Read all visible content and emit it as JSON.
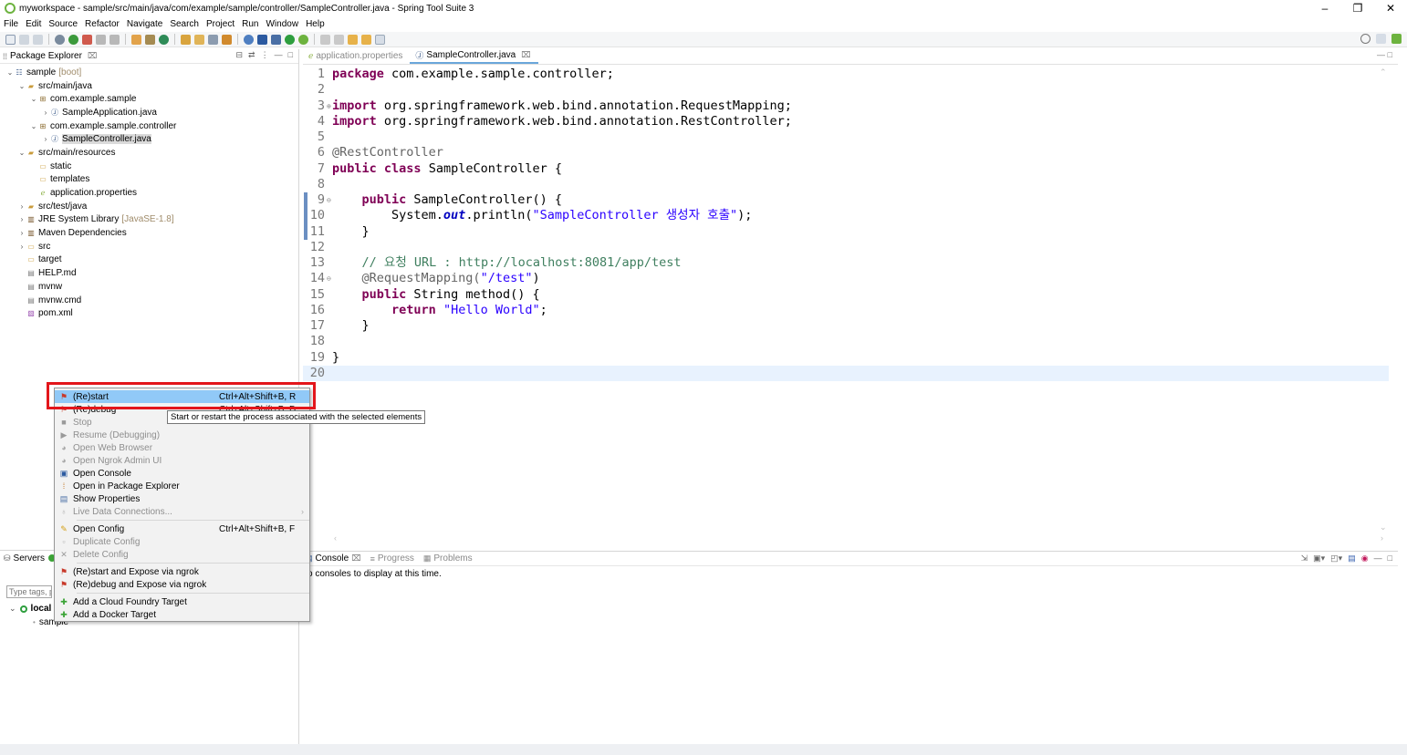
{
  "window": {
    "title": "myworkspace - sample/src/main/java/com/example/sample/controller/SampleController.java - Spring Tool Suite 3",
    "controls": [
      "–",
      "❐",
      "✕"
    ]
  },
  "menubar": [
    "File",
    "Edit",
    "Source",
    "Refactor",
    "Navigate",
    "Search",
    "Project",
    "Run",
    "Window",
    "Help"
  ],
  "package_explorer": {
    "title": "Package Explorer",
    "close": "⌧",
    "tree": [
      {
        "label": "sample",
        "decoration": "[boot]",
        "indent": 0,
        "twisty": "⌄",
        "icon": "project-icon"
      },
      {
        "label": "src/main/java",
        "indent": 1,
        "twisty": "⌄",
        "icon": "source-folder-icon"
      },
      {
        "label": "com.example.sample",
        "indent": 2,
        "twisty": "⌄",
        "icon": "package-icon"
      },
      {
        "label": "SampleApplication.java",
        "indent": 3,
        "twisty": "›",
        "icon": "java-file-icon"
      },
      {
        "label": "com.example.sample.controller",
        "indent": 2,
        "twisty": "⌄",
        "icon": "package-icon"
      },
      {
        "label": "SampleController.java",
        "indent": 3,
        "twisty": "›",
        "icon": "java-file-icon",
        "selected": true
      },
      {
        "label": "src/main/resources",
        "indent": 1,
        "twisty": "⌄",
        "icon": "source-folder-icon"
      },
      {
        "label": "static",
        "indent": 2,
        "twisty": "",
        "icon": "folder-icon"
      },
      {
        "label": "templates",
        "indent": 2,
        "twisty": "",
        "icon": "folder-icon"
      },
      {
        "label": "application.properties",
        "indent": 2,
        "twisty": "",
        "icon": "properties-icon"
      },
      {
        "label": "src/test/java",
        "indent": 1,
        "twisty": "›",
        "icon": "source-folder-icon"
      },
      {
        "label": "JRE System Library",
        "decoration": "[JavaSE-1.8]",
        "indent": 1,
        "twisty": "›",
        "icon": "library-icon"
      },
      {
        "label": "Maven Dependencies",
        "indent": 1,
        "twisty": "›",
        "icon": "library-icon"
      },
      {
        "label": "src",
        "indent": 1,
        "twisty": "›",
        "icon": "folder-icon"
      },
      {
        "label": "target",
        "indent": 1,
        "twisty": "",
        "icon": "folder-icon"
      },
      {
        "label": "HELP.md",
        "indent": 1,
        "twisty": "",
        "icon": "file-icon"
      },
      {
        "label": "mvnw",
        "indent": 1,
        "twisty": "",
        "icon": "file-icon"
      },
      {
        "label": "mvnw.cmd",
        "indent": 1,
        "twisty": "",
        "icon": "file-icon"
      },
      {
        "label": "pom.xml",
        "indent": 1,
        "twisty": "",
        "icon": "xml-file-icon"
      }
    ]
  },
  "servers": {
    "tab_label": "Servers",
    "filter_placeholder": "Type tags, p",
    "local_label": "local",
    "child_label": "sample"
  },
  "editor": {
    "tabs": [
      {
        "label": "application.properties",
        "active": false
      },
      {
        "label": "SampleController.java",
        "active": true,
        "close": "⌧"
      }
    ],
    "lines": [
      {
        "n": "1",
        "fold": "",
        "tokens": [
          [
            "kw",
            "package"
          ],
          [
            "t",
            " com.example.sample.controller;"
          ]
        ]
      },
      {
        "n": "2",
        "fold": "",
        "tokens": []
      },
      {
        "n": "3",
        "fold": "⊕",
        "tokens": [
          [
            "kw",
            "import"
          ],
          [
            "t",
            " org.springframework.web.bind.annotation.RequestMapping;"
          ]
        ]
      },
      {
        "n": "4",
        "fold": "",
        "tokens": [
          [
            "kw",
            "import"
          ],
          [
            "t",
            " org.springframework.web.bind.annotation.RestController;"
          ]
        ]
      },
      {
        "n": "5",
        "fold": "",
        "tokens": []
      },
      {
        "n": "6",
        "fold": "",
        "tokens": [
          [
            "ann",
            "@RestController"
          ]
        ]
      },
      {
        "n": "7",
        "fold": "",
        "tokens": [
          [
            "kw",
            "public"
          ],
          [
            "t",
            " "
          ],
          [
            "kw",
            "class"
          ],
          [
            "t",
            " SampleController {"
          ]
        ]
      },
      {
        "n": "8",
        "fold": "",
        "tokens": []
      },
      {
        "n": "9",
        "fold": "⊖",
        "tokens": [
          [
            "t",
            "    "
          ],
          [
            "kw",
            "public"
          ],
          [
            "t",
            " SampleController() {"
          ]
        ]
      },
      {
        "n": "10",
        "fold": "",
        "tokens": [
          [
            "t",
            "        System."
          ],
          [
            "fld",
            "out"
          ],
          [
            "t",
            ".println("
          ],
          [
            "str",
            "\"SampleController 생성자 호출\""
          ],
          [
            "t",
            ");"
          ]
        ]
      },
      {
        "n": "11",
        "fold": "",
        "tokens": [
          [
            "t",
            "    }"
          ]
        ]
      },
      {
        "n": "12",
        "fold": "",
        "tokens": []
      },
      {
        "n": "13",
        "fold": "",
        "tokens": [
          [
            "t",
            "    "
          ],
          [
            "com",
            "// 요청 URL : http://localhost:8081/app/test"
          ]
        ]
      },
      {
        "n": "14",
        "fold": "⊖",
        "tokens": [
          [
            "t",
            "    "
          ],
          [
            "ann",
            "@RequestMapping("
          ],
          [
            "str",
            "\"/test\""
          ],
          [
            "t",
            ")"
          ]
        ]
      },
      {
        "n": "15",
        "fold": "",
        "tokens": [
          [
            "t",
            "    "
          ],
          [
            "kw",
            "public"
          ],
          [
            "t",
            " String method() {"
          ]
        ]
      },
      {
        "n": "16",
        "fold": "",
        "tokens": [
          [
            "t",
            "        "
          ],
          [
            "kw",
            "return"
          ],
          [
            "t",
            " "
          ],
          [
            "str",
            "\"Hello World\""
          ],
          [
            "t",
            ";"
          ]
        ]
      },
      {
        "n": "17",
        "fold": "",
        "tokens": [
          [
            "t",
            "    }"
          ]
        ]
      },
      {
        "n": "18",
        "fold": "",
        "tokens": []
      },
      {
        "n": "19",
        "fold": "",
        "tokens": [
          [
            "t",
            "}"
          ]
        ]
      },
      {
        "n": "20",
        "fold": "",
        "tokens": [],
        "current": true
      }
    ]
  },
  "console": {
    "tabs": [
      {
        "label": "Console",
        "active": true,
        "close": "⌧"
      },
      {
        "label": "Progress",
        "active": false
      },
      {
        "label": "Problems",
        "active": false
      }
    ],
    "message": "o consoles to display at this time."
  },
  "context_menu": {
    "items": [
      {
        "label": "(Re)start",
        "accel": "Ctrl+Alt+Shift+B, R",
        "icon": "restart-icon",
        "highlight": true
      },
      {
        "label": "(Re)debug",
        "accel": "Ctrl+Alt+Shift+B, D",
        "icon": "debug-icon"
      },
      {
        "label": "Stop",
        "icon": "stop-icon",
        "disabled": true
      },
      {
        "label": "Resume (Debugging)",
        "icon": "resume-icon",
        "disabled": true
      },
      {
        "label": "Open Web Browser",
        "icon": "globe-icon",
        "disabled": true
      },
      {
        "label": "Open Ngrok Admin UI",
        "icon": "globe-icon",
        "disabled": true
      },
      {
        "label": "Open Console",
        "icon": "console-icon"
      },
      {
        "label": "Open in Package Explorer",
        "icon": "package-explorer-icon"
      },
      {
        "label": "Show Properties",
        "icon": "properties-icon"
      },
      {
        "label": "Live Data Connections...",
        "icon": "lightbulb-icon",
        "disabled": true,
        "submenu": true,
        "sep_after": true
      },
      {
        "label": "Open Config",
        "accel": "Ctrl+Alt+Shift+B, F",
        "icon": "pencil-icon"
      },
      {
        "label": "Duplicate Config",
        "icon": "duplicate-icon",
        "disabled": true
      },
      {
        "label": "Delete Config",
        "icon": "delete-icon",
        "disabled": true,
        "sep_after": true
      },
      {
        "label": "(Re)start and Expose via ngrok",
        "icon": "restart-icon"
      },
      {
        "label": "(Re)debug and Expose via ngrok",
        "icon": "debug-icon",
        "sep_after": true
      },
      {
        "label": "Add a Cloud Foundry Target",
        "icon": "add-icon"
      },
      {
        "label": "Add a Docker Target",
        "icon": "add-icon"
      }
    ],
    "tooltip": "Start or restart the process associated with the selected elements"
  },
  "colors": {
    "highlight": "#91c9f7",
    "annotation_box": "#e3161b",
    "keyword": "#7f0055",
    "string": "#2a00ff",
    "comment": "#3f7f5f"
  }
}
